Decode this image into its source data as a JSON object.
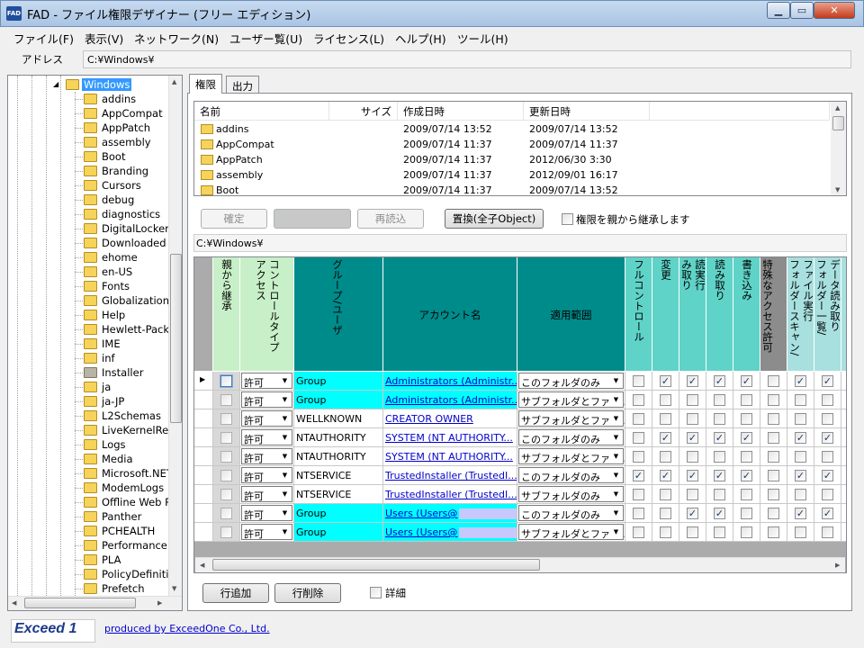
{
  "window": {
    "title": "FAD - ファイル権限デザイナー (フリー エディション)",
    "app_icon": "FAD"
  },
  "menu": [
    "ファイル(F)",
    "表示(V)",
    "ネットワーク(N)",
    "ユーザー覧(U)",
    "ライセンス(L)",
    "ヘルプ(H)",
    "ツール(H)"
  ],
  "address": {
    "label": "アドレス",
    "value": "C:¥Windows¥"
  },
  "tree": {
    "selected": "Windows",
    "items": [
      "addins",
      "AppCompat",
      "AppPatch",
      "assembly",
      "Boot",
      "Branding",
      "Cursors",
      "debug",
      "diagnostics",
      "DigitalLocker",
      "Downloaded P",
      "ehome",
      "en-US",
      "Fonts",
      "Globalization",
      "Help",
      "Hewlett-Packa",
      "IME",
      "inf",
      "Installer",
      "ja",
      "ja-JP",
      "L2Schemas",
      "LiveKernelRep",
      "Logs",
      "Media",
      "Microsoft.NET",
      "ModemLogs",
      "Offline Web Pa",
      "Panther",
      "PCHEALTH",
      "Performance",
      "PLA",
      "PolicyDefinitic",
      "Prefetch"
    ],
    "gray_items": [
      "Installer"
    ]
  },
  "tabs": [
    "権限",
    "出力"
  ],
  "file_list": {
    "headers": [
      "名前",
      "サイズ",
      "作成日時",
      "更新日時"
    ],
    "rows": [
      {
        "name": "addins",
        "created": "2009/07/14 13:52",
        "modified": "2009/07/14 13:52"
      },
      {
        "name": "AppCompat",
        "created": "2009/07/14 11:37",
        "modified": "2009/07/14 11:37"
      },
      {
        "name": "AppPatch",
        "created": "2009/07/14 11:37",
        "modified": "2012/06/30 3:30"
      },
      {
        "name": "assembly",
        "created": "2009/07/14 11:37",
        "modified": "2012/09/01 16:17"
      },
      {
        "name": "Boot",
        "created": "2009/07/14 11:37",
        "modified": "2009/07/14 13:52"
      }
    ]
  },
  "actions": {
    "confirm": "確定",
    "reload": "再読込",
    "replace": "置換(全子Object)",
    "inherit_label": "権限を親から継承します",
    "inherit_checked": false
  },
  "path": "C:¥Windows¥",
  "grid": {
    "headers": {
      "inherit": "親から継承",
      "control_type": "コントロールタイプ\nアクセス",
      "group": "グループ/ユーザ",
      "account": "アカウント名",
      "scope": "適用範囲",
      "full": "フルコントロール",
      "change": "変更",
      "read_exec": "読実行\nみ取り",
      "read": "読み取り",
      "write": "書き込み",
      "special": "特殊なアクセス許可",
      "traverse": "ファイル実行\nフォルダースキャン/",
      "list": "データ読み取り\nフォルダー一覧/"
    },
    "rows": [
      {
        "access": "許可",
        "group": "Group",
        "account": "Administrators (Administr...",
        "scope": "このフォルダのみ",
        "cyan": true,
        "perms": [
          false,
          true,
          true,
          true,
          true,
          false,
          true,
          true
        ],
        "current": true
      },
      {
        "access": "許可",
        "group": "Group",
        "account": "Administrators (Administr...",
        "scope": "サブフォルダとファイ...",
        "cyan": true,
        "perms": [
          false,
          false,
          false,
          false,
          false,
          false,
          false,
          false
        ]
      },
      {
        "access": "許可",
        "group": "WELLKNOWN",
        "account": "CREATOR OWNER",
        "scope": "サブフォルダとファイ...",
        "cyan": false,
        "perms": [
          false,
          false,
          false,
          false,
          false,
          false,
          false,
          false
        ]
      },
      {
        "access": "許可",
        "group": "NTAUTHORITY",
        "account": "SYSTEM (NT AUTHORITY...",
        "scope": "このフォルダのみ",
        "cyan": false,
        "perms": [
          false,
          true,
          true,
          true,
          true,
          false,
          true,
          true
        ]
      },
      {
        "access": "許可",
        "group": "NTAUTHORITY",
        "account": "SYSTEM (NT AUTHORITY...",
        "scope": "サブフォルダとファイ...",
        "cyan": false,
        "perms": [
          false,
          false,
          false,
          false,
          false,
          false,
          false,
          false
        ]
      },
      {
        "access": "許可",
        "group": "NTSERVICE",
        "account": "TrustedInstaller (TrustedI...",
        "scope": "このフォルダのみ",
        "cyan": false,
        "perms": [
          true,
          true,
          true,
          true,
          true,
          false,
          true,
          true
        ]
      },
      {
        "access": "許可",
        "group": "NTSERVICE",
        "account": "TrustedInstaller (TrustedI...",
        "scope": "サブフォルダのみ",
        "cyan": false,
        "perms": [
          false,
          false,
          false,
          false,
          false,
          false,
          false,
          false
        ]
      },
      {
        "access": "許可",
        "group": "Group",
        "account": "Users (Users@",
        "scope": "このフォルダのみ",
        "cyan": true,
        "redacted": true,
        "perms": [
          false,
          false,
          true,
          true,
          false,
          false,
          true,
          true
        ]
      },
      {
        "access": "許可",
        "group": "Group",
        "account": "Users (Users@",
        "scope": "サブフォルダとファイ...",
        "cyan": true,
        "redacted": true,
        "perms": [
          false,
          false,
          false,
          false,
          false,
          false,
          false,
          false
        ]
      }
    ]
  },
  "bottom": {
    "add_row": "行追加",
    "delete_row": "行削除",
    "detail_label": "詳細"
  },
  "footer": {
    "logo": "Exceed 1",
    "credit": "produced by ExceedOne Co., Ltd."
  },
  "colors": {
    "header_green": "#c8f0c8",
    "header_teal": "#008b8b",
    "header_lightteal": "#5fd3c8",
    "header_gray": "#8c8c8c",
    "header_palecyan": "#a8e0e0",
    "cell_cyan": "#00ffff"
  }
}
